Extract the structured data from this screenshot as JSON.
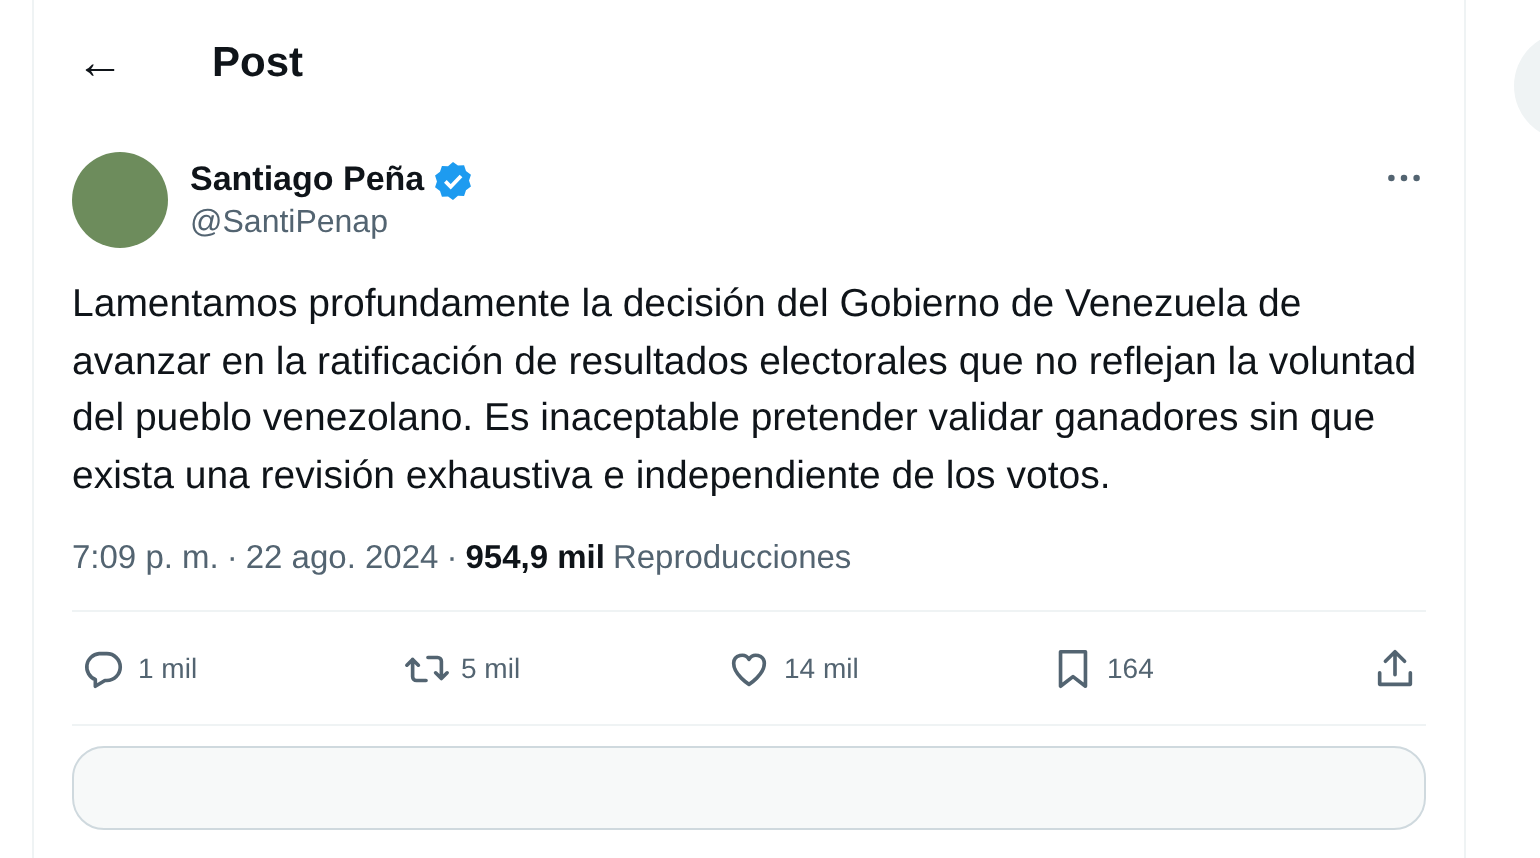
{
  "header": {
    "back": "←",
    "title": "Post"
  },
  "author": {
    "name": "Santiago Peña",
    "verified": true,
    "handle": "@SantiPenap"
  },
  "text": "Lamentamos profundamente la decisión del Gobierno de Venezuela de avanzar en la ratificación de resultados electorales que no reflejan la voluntad del pueblo venezolano. Es inaceptable pretender validar ganadores sin que exista una revisión exhaustiva e independiente de los votos.",
  "meta": {
    "time": "7:09 p. m.",
    "separators": [
      "·",
      "·"
    ],
    "date": "22 ago. 2024",
    "views": "954,9 mil",
    "views_label": "Reproducciones"
  },
  "actions": [
    {
      "kind": "reply",
      "count": "1 mil"
    },
    {
      "kind": "repost",
      "count": "5 mil"
    },
    {
      "kind": "like",
      "count": "14 mil"
    },
    {
      "kind": "bookmark",
      "count": "164"
    },
    {
      "kind": "share"
    }
  ]
}
